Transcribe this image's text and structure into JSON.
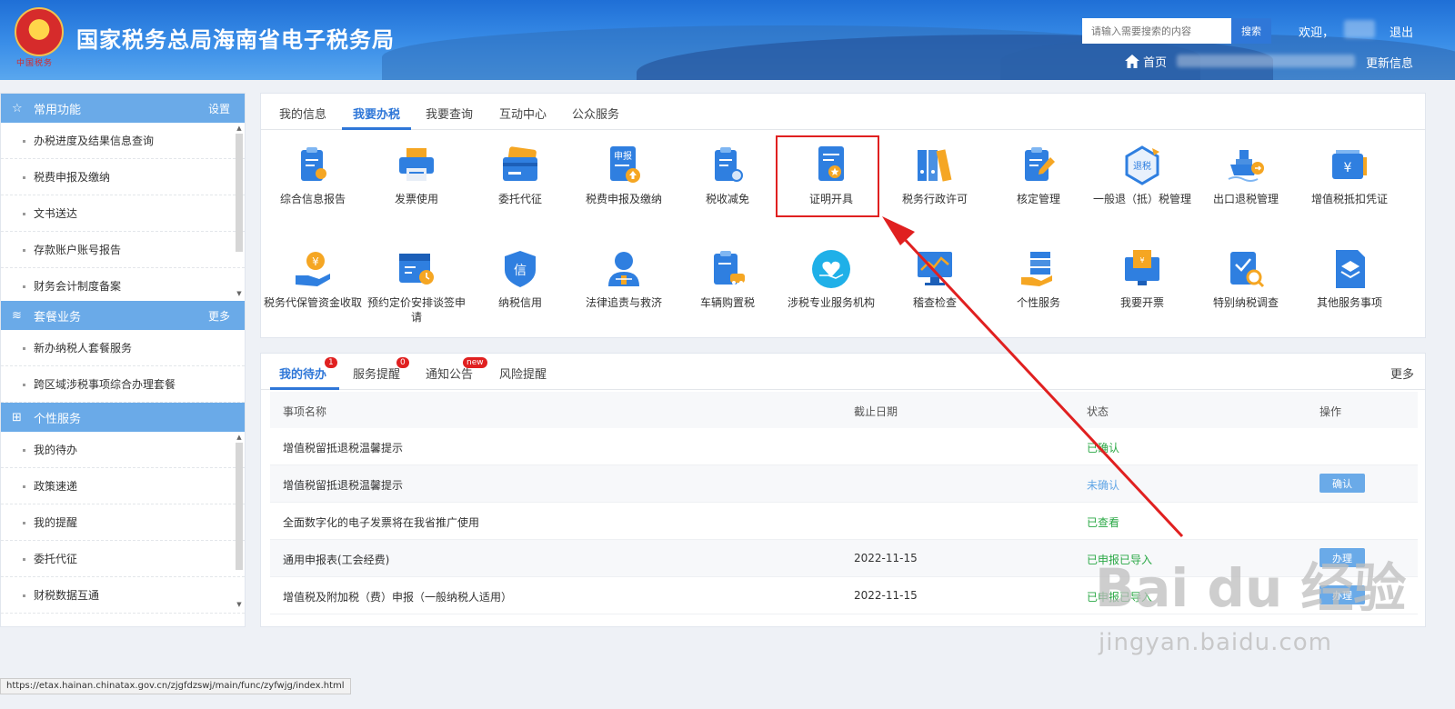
{
  "header": {
    "site_title": "国家税务总局海南省电子税务局",
    "emblem_text": "中国税务",
    "search_placeholder": "请输入需要搜索的内容",
    "search_button": "搜索",
    "welcome": "欢迎，",
    "logout": "退出",
    "home": "首页",
    "update_info": "更新信息"
  },
  "sidebar": {
    "sections": [
      {
        "title": "常用功能",
        "link": "设置",
        "icon": "star-icon",
        "items": [
          "办税进度及结果信息查询",
          "税费申报及缴纳",
          "文书送达",
          "存款账户账号报告",
          "财务会计制度备案"
        ]
      },
      {
        "title": "套餐业务",
        "link": "更多",
        "icon": "layers-icon",
        "items": [
          "新办纳税人套餐服务",
          "跨区域涉税事项综合办理套餐"
        ]
      },
      {
        "title": "个性服务",
        "link": "",
        "icon": "grid-icon",
        "items": [
          "我的待办",
          "政策速递",
          "我的提醒",
          "委托代征",
          "财税数据互通"
        ]
      }
    ]
  },
  "main_tabs": [
    "我的信息",
    "我要办税",
    "我要查询",
    "互动中心",
    "公众服务"
  ],
  "services": {
    "row1": [
      "综合信息报告",
      "发票使用",
      "委托代征",
      "税费申报及缴纳",
      "税收减免",
      "证明开具",
      "税务行政许可",
      "核定管理",
      "一般退（抵）税管理",
      "出口退税管理",
      "增值税抵扣凭证"
    ],
    "row2": [
      "税务代保管资金收取",
      "预约定价安排谈签申请",
      "纳税信用",
      "法律追责与救济",
      "车辆购置税",
      "涉税专业服务机构",
      "稽查检查",
      "个性服务",
      "我要开票",
      "特别纳税调查",
      "其他服务事项"
    ]
  },
  "todo": {
    "tabs": [
      {
        "label": "我的待办",
        "badge": "1"
      },
      {
        "label": "服务提醒",
        "badge": "0"
      },
      {
        "label": "通知公告",
        "badge": "new"
      },
      {
        "label": "风险提醒",
        "badge": ""
      }
    ],
    "more": "更多",
    "columns": [
      "事项名称",
      "截止日期",
      "状态",
      "操作"
    ],
    "rows": [
      {
        "name": "增值税留抵退税温馨提示",
        "date": "",
        "status": "已确认",
        "action": ""
      },
      {
        "name": "增值税留抵退税温馨提示",
        "date": "",
        "status": "未确认",
        "action": "确认"
      },
      {
        "name": "全面数字化的电子发票将在我省推广使用",
        "date": "",
        "status": "已查看",
        "action": ""
      },
      {
        "name": "通用申报表(工会经费)",
        "date": "2022-11-15",
        "status": "已申报已导入",
        "action": "办理"
      },
      {
        "name": "增值税及附加税（费）申报（一般纳税人适用）",
        "date": "2022-11-15",
        "status": "已申报已导入",
        "action": "办理"
      }
    ]
  },
  "statusbar_url": "https://etax.hainan.chinatax.gov.cn/zjgfdzswj/main/func/zyfwjg/index.html",
  "watermark": {
    "logo": "Bai  du 经验",
    "sub": "jingyan.baidu.com"
  },
  "colors": {
    "accent": "#2f77d8",
    "sidebar_head": "#6aaae8",
    "highlight": "#e02020",
    "status_green": "#2aa845",
    "status_blue": "#62a6e6"
  }
}
